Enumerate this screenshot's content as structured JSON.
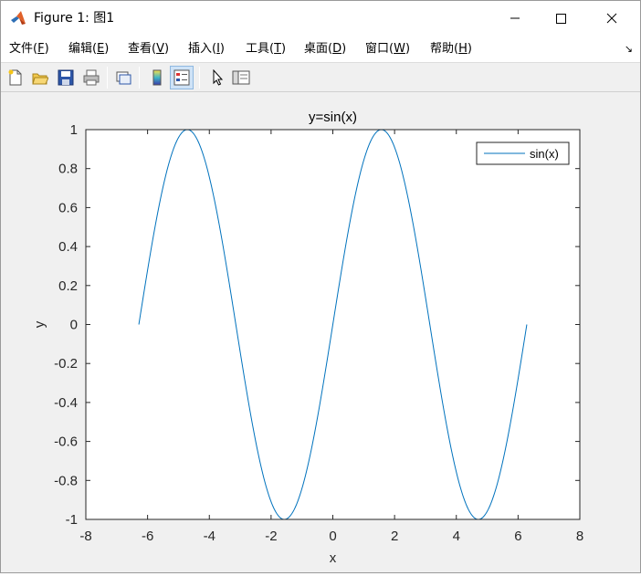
{
  "window": {
    "title": "Figure 1: 图1",
    "controls": {
      "minimize": "minimize",
      "maximize": "maximize",
      "close": "close"
    }
  },
  "menubar": {
    "items": [
      {
        "label": "文件(",
        "key": "F",
        "tail": ")"
      },
      {
        "label": "编辑(",
        "key": "E",
        "tail": ")"
      },
      {
        "label": "查看(",
        "key": "V",
        "tail": ")"
      },
      {
        "label": "插入(",
        "key": "I",
        "tail": ")"
      },
      {
        "label": "工具(",
        "key": "T",
        "tail": ")"
      },
      {
        "label": "桌面(",
        "key": "D",
        "tail": ")"
      },
      {
        "label": "窗口(",
        "key": "W",
        "tail": ")"
      },
      {
        "label": "帮助(",
        "key": "H",
        "tail": ")"
      }
    ]
  },
  "toolbar": {
    "buttons": [
      "new-figure-icon",
      "open-icon",
      "save-icon",
      "print-icon",
      "link-icon",
      "colorbar-icon",
      "legend-icon",
      "pointer-icon",
      "property-editor-icon"
    ]
  },
  "colors": {
    "line": "#0072bd",
    "axes_bg": "#ffffff",
    "figure_bg": "#f0f0f0",
    "axis_color": "#262626"
  },
  "chart_data": {
    "type": "line",
    "title": "y=sin(x)",
    "xlabel": "x",
    "ylabel": "y",
    "xlim": [
      -8,
      8
    ],
    "ylim": [
      -1,
      1
    ],
    "xticks": [
      "-8",
      "-6",
      "-4",
      "-2",
      "0",
      "2",
      "4",
      "6",
      "8"
    ],
    "yticks": [
      "1",
      "0.8",
      "0.6",
      "0.4",
      "0.2",
      "0",
      "-0.2",
      "-0.4",
      "-0.6",
      "-0.8",
      "-1"
    ],
    "grid": false,
    "legend_position": "top-right",
    "series": [
      {
        "name": "sin(x)",
        "function": "sin(x)",
        "x_range": [
          -6.2832,
          6.2832
        ],
        "points": [
          [
            -6.2832,
            0
          ],
          [
            -5.4978,
            0.7071
          ],
          [
            -4.7124,
            1
          ],
          [
            -3.927,
            0.7071
          ],
          [
            -3.1416,
            0
          ],
          [
            -2.3562,
            -0.7071
          ],
          [
            -1.5708,
            -1
          ],
          [
            -0.7854,
            -0.7071
          ],
          [
            0,
            0
          ],
          [
            0.7854,
            0.7071
          ],
          [
            1.5708,
            1
          ],
          [
            2.3562,
            0.7071
          ],
          [
            3.1416,
            0
          ],
          [
            3.927,
            -0.7071
          ],
          [
            4.7124,
            -1
          ],
          [
            5.4978,
            -0.7071
          ],
          [
            6.2832,
            0
          ]
        ]
      }
    ]
  }
}
